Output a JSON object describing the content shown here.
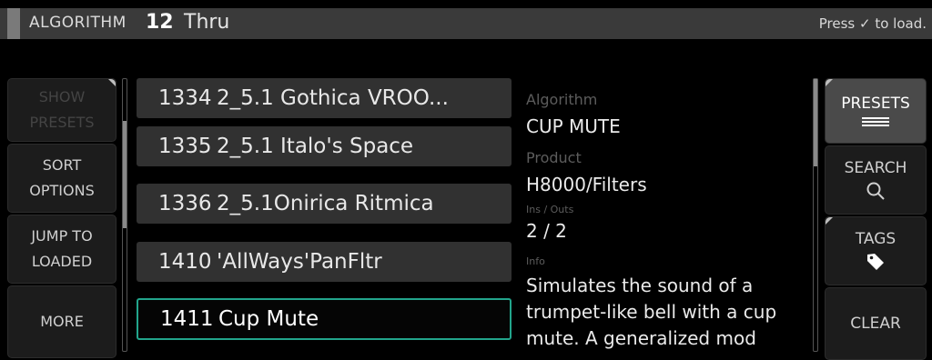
{
  "header": {
    "label": "ALGORITHM",
    "number": "12",
    "name": "Thru",
    "hint": "Press ✓ to load."
  },
  "left_buttons": [
    {
      "line1": "SHOW",
      "line2": "PRESETS",
      "enabled": false
    },
    {
      "line1": "SORT",
      "line2": "OPTIONS",
      "enabled": true
    },
    {
      "line1": "JUMP TO",
      "line2": "LOADED",
      "enabled": true
    },
    {
      "line1": "MORE",
      "line2": "",
      "enabled": true
    }
  ],
  "presets": [
    {
      "number": "1334",
      "name": "2_5.1 Gothica VROO..."
    },
    {
      "number": "1335",
      "name": "2_5.1 Italo's Space"
    },
    {
      "number": "1336",
      "name": "2_5.1Onirica Ritmica"
    },
    {
      "number": "1410",
      "name": "'AllWays'PanFltr"
    },
    {
      "number": "1411",
      "name": "Cup Mute",
      "selected": true
    }
  ],
  "details": {
    "algorithm_label": "Algorithm",
    "algorithm_value": "CUP MUTE",
    "product_label": "Product",
    "product_value": "H8000/Filters",
    "io_label": "Ins / Outs",
    "io_value": "2 / 2",
    "info_label": "Info",
    "info_value": "Simulates the sound of a trumpet-like bell with a cup mute. A generalized mod"
  },
  "right_buttons": [
    {
      "label": "PRESETS",
      "icon": "menu-lines-icon",
      "active": true
    },
    {
      "label": "SEARCH",
      "icon": "magnifier-icon",
      "active": false
    },
    {
      "label": "TAGS",
      "icon": "tag-icon",
      "active": false
    },
    {
      "label": "CLEAR",
      "icon": "",
      "active": false
    }
  ],
  "colors": {
    "selection_border": "#22a58c",
    "row_bg": "#313131",
    "header_bg": "#3a3a3a"
  }
}
